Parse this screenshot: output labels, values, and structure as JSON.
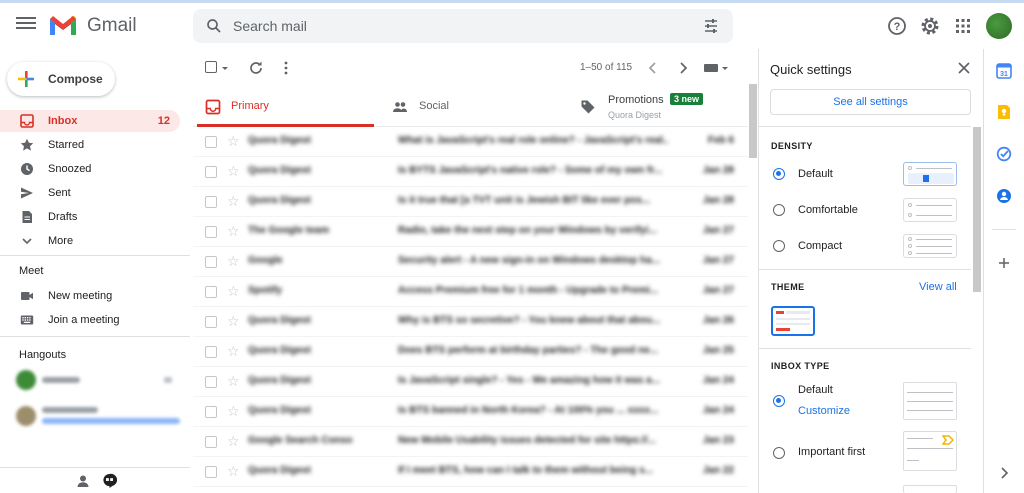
{
  "header": {
    "brand": "Gmail",
    "search_placeholder": "Search mail"
  },
  "sidebar": {
    "compose_label": "Compose",
    "items": [
      {
        "label": "Inbox",
        "count": "12",
        "icon": "inbox-icon",
        "active": true
      },
      {
        "label": "Starred",
        "icon": "star-icon"
      },
      {
        "label": "Snoozed",
        "icon": "clock-icon"
      },
      {
        "label": "Sent",
        "icon": "send-icon"
      },
      {
        "label": "Drafts",
        "icon": "draft-icon"
      },
      {
        "label": "More",
        "icon": "chevron-down-icon"
      }
    ],
    "meet_title": "Meet",
    "meet_items": [
      {
        "label": "New meeting",
        "icon": "video-icon"
      },
      {
        "label": "Join a meeting",
        "icon": "keyboard-icon"
      }
    ],
    "hangouts_title": "Hangouts"
  },
  "toolbar": {
    "pager": "1–50 of 115"
  },
  "tabs": [
    {
      "label": "Primary",
      "icon": "inbox-icon",
      "active": true
    },
    {
      "label": "Social",
      "icon": "people-icon"
    },
    {
      "label": "Promotions",
      "icon": "tag-icon",
      "badge": "3 new",
      "subtitle": "Quora Digest"
    }
  ],
  "emails": [
    {
      "sender": "Quora Digest",
      "subject": "What is JavaScript's real role online? - JavaScript's real...",
      "date": "Feb 6"
    },
    {
      "sender": "Quora Digest",
      "subject": "Is BYTS JavaScript's native role? - Some of my own fr...",
      "date": "Jan 28"
    },
    {
      "sender": "Quora Digest",
      "subject": "Is it true that [a TVT unit is Jewish BIT like ever pos...",
      "date": "Jan 28"
    },
    {
      "sender": "The Google team",
      "subject": "Radio, take the next step on your Windows by verifyi...",
      "date": "Jan 27"
    },
    {
      "sender": "Google",
      "subject": "Security alert - A new sign-in on Windows desktop ha...",
      "date": "Jan 27"
    },
    {
      "sender": "Spotify",
      "subject": "Access Premium free for 1 month - Upgrade to Premi...",
      "date": "Jan 27"
    },
    {
      "sender": "Quora Digest",
      "subject": "Why is BTS so secretive? - You knew about that abou...",
      "date": "Jan 26"
    },
    {
      "sender": "Quora Digest",
      "subject": "Does BTS perform at birthday parties? - The good ne...",
      "date": "Jan 25"
    },
    {
      "sender": "Quora Digest",
      "subject": "Is JavaScript single? - Yes - We amazing how it was a...",
      "date": "Jan 24"
    },
    {
      "sender": "Quora Digest",
      "subject": "Is BTS banned in North Korea? - At 100% you ... xxxx...",
      "date": "Jan 24"
    },
    {
      "sender": "Google Search Conso",
      "subject": "New Mobile Usability issues detected for site https://...",
      "date": "Jan 23"
    },
    {
      "sender": "Quora Digest",
      "subject": "If I meet BTS, how can I talk to them without being s...",
      "date": "Jan 22"
    }
  ],
  "quick_settings": {
    "title": "Quick settings",
    "see_all": "See all settings",
    "density_title": "DENSITY",
    "density_options": [
      {
        "label": "Default",
        "selected": true
      },
      {
        "label": "Comfortable",
        "selected": false
      },
      {
        "label": "Compact",
        "selected": false
      }
    ],
    "theme_title": "THEME",
    "view_all": "View all",
    "inbox_type_title": "INBOX TYPE",
    "inbox_options": [
      {
        "label": "Default",
        "selected": true,
        "link": "Customize"
      },
      {
        "label": "Important first",
        "selected": false
      }
    ]
  },
  "colors": {
    "accent_red": "#d93025",
    "link_blue": "#1a73e8",
    "badge_green": "#188038"
  }
}
